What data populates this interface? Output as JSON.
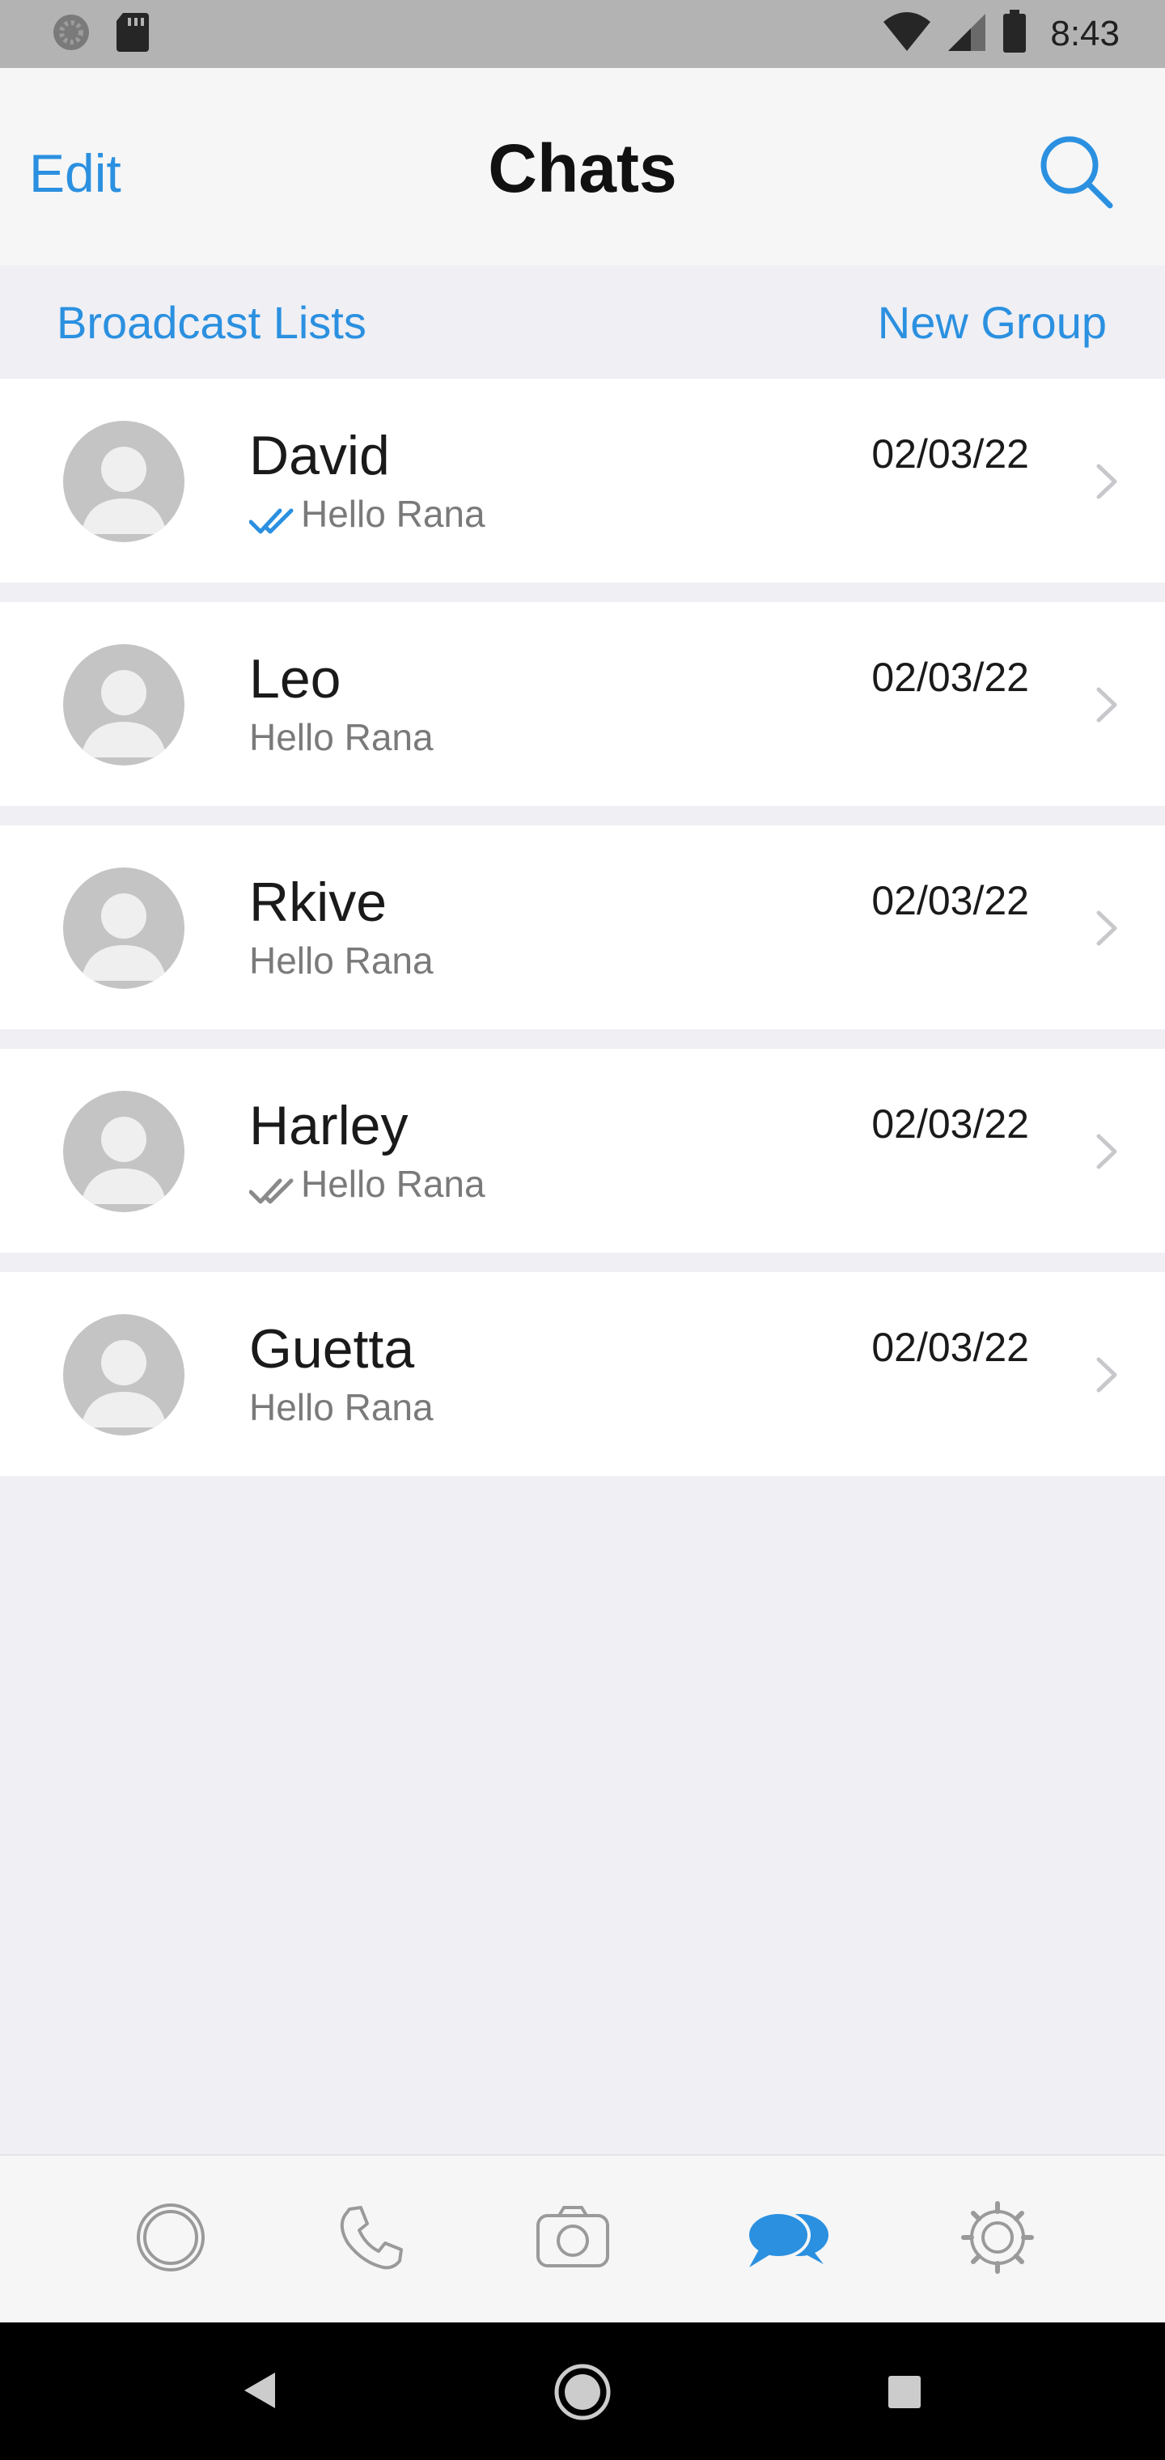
{
  "status_bar": {
    "time": "8:43",
    "icons": [
      "loading-icon",
      "sd-card-icon",
      "wifi-icon",
      "signal-icon",
      "battery-icon"
    ]
  },
  "header": {
    "edit_label": "Edit",
    "title": "Chats",
    "search_icon": "search-icon"
  },
  "subheader": {
    "broadcast_label": "Broadcast Lists",
    "new_group_label": "New Group"
  },
  "chats": [
    {
      "name": "David",
      "preview": "Hello Rana",
      "date": "02/03/22",
      "receipt": "read"
    },
    {
      "name": "Leo",
      "preview": "Hello Rana",
      "date": "02/03/22",
      "receipt": "none"
    },
    {
      "name": "Rkive",
      "preview": "Hello Rana",
      "date": "02/03/22",
      "receipt": "none"
    },
    {
      "name": "Harley",
      "preview": "Hello Rana",
      "date": "02/03/22",
      "receipt": "delivered"
    },
    {
      "name": "Guetta",
      "preview": "Hello Rana",
      "date": "02/03/22",
      "receipt": "none"
    }
  ],
  "tab_bar": {
    "tabs": [
      "status-icon",
      "phone-icon",
      "camera-icon",
      "chats-icon",
      "settings-icon"
    ],
    "active_tab": "chats-icon"
  },
  "colors": {
    "accent": "#2b90e0",
    "read_tick": "#2b90e0",
    "delivered_tick": "#8a8a8a",
    "inactive_icon": "#9a9a9a"
  },
  "android_nav": [
    "back-icon",
    "home-icon",
    "recents-icon"
  ]
}
